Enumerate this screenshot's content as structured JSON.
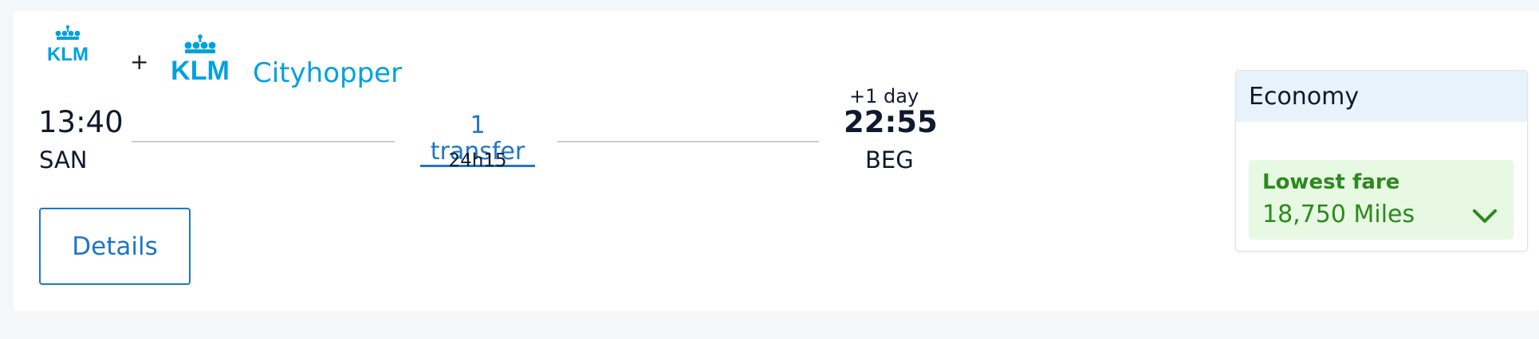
{
  "logos": {
    "primary": "KLM",
    "plus": "+",
    "secondary": "KLM",
    "secondary_suffix": "Cityhopper",
    "brand_color": "#00a1de"
  },
  "flight": {
    "departure_time": "13:40",
    "departure_code": "SAN",
    "arrival_time": "22:55",
    "arrival_code": "BEG",
    "arrival_day_offset": "+1 day",
    "transfer_label": "1 transfer",
    "duration": "24h15"
  },
  "actions": {
    "details_label": "Details"
  },
  "fare": {
    "cabin": "Economy",
    "label": "Lowest fare",
    "price": "18,750 Miles",
    "icon": "chevron-down-icon",
    "accent_color": "#2d8a1d"
  }
}
